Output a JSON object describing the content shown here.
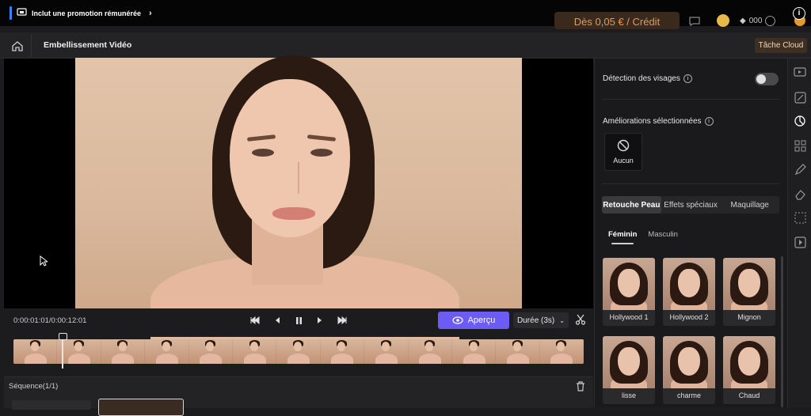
{
  "topbar": {
    "promo_label": "Inclut une promotion rémunérée",
    "credit_label": "Dès 0,05 € / Crédit",
    "counter": "000"
  },
  "header": {
    "title": "Embellissement Vidéo",
    "cloud_button": "Tâche Cloud"
  },
  "player": {
    "timecode": "0:00:01:01/0:00:12:01",
    "preview_label": "Aperçu",
    "duration_label": "Durée (3s)"
  },
  "sequence": {
    "label": "Séquence(1/1)"
  },
  "panel": {
    "face_detection_label": "Détection des visages",
    "face_detection_on": false,
    "selected_label": "Améliorations sélectionnées",
    "none_label": "Aucun",
    "tabs": [
      "Retouche Peau",
      "Effets spéciaux",
      "Maquillage"
    ],
    "genders": [
      "Féminin",
      "Masculin"
    ],
    "presets": [
      "Hollywood 1",
      "Hollywood 2",
      "Mignon",
      "lisse",
      "charme",
      "Chaud"
    ]
  },
  "colors": {
    "accent": "#6c5cf5",
    "cloud_btn_bg": "#3d2f22",
    "credit_text": "#e09a5a"
  }
}
